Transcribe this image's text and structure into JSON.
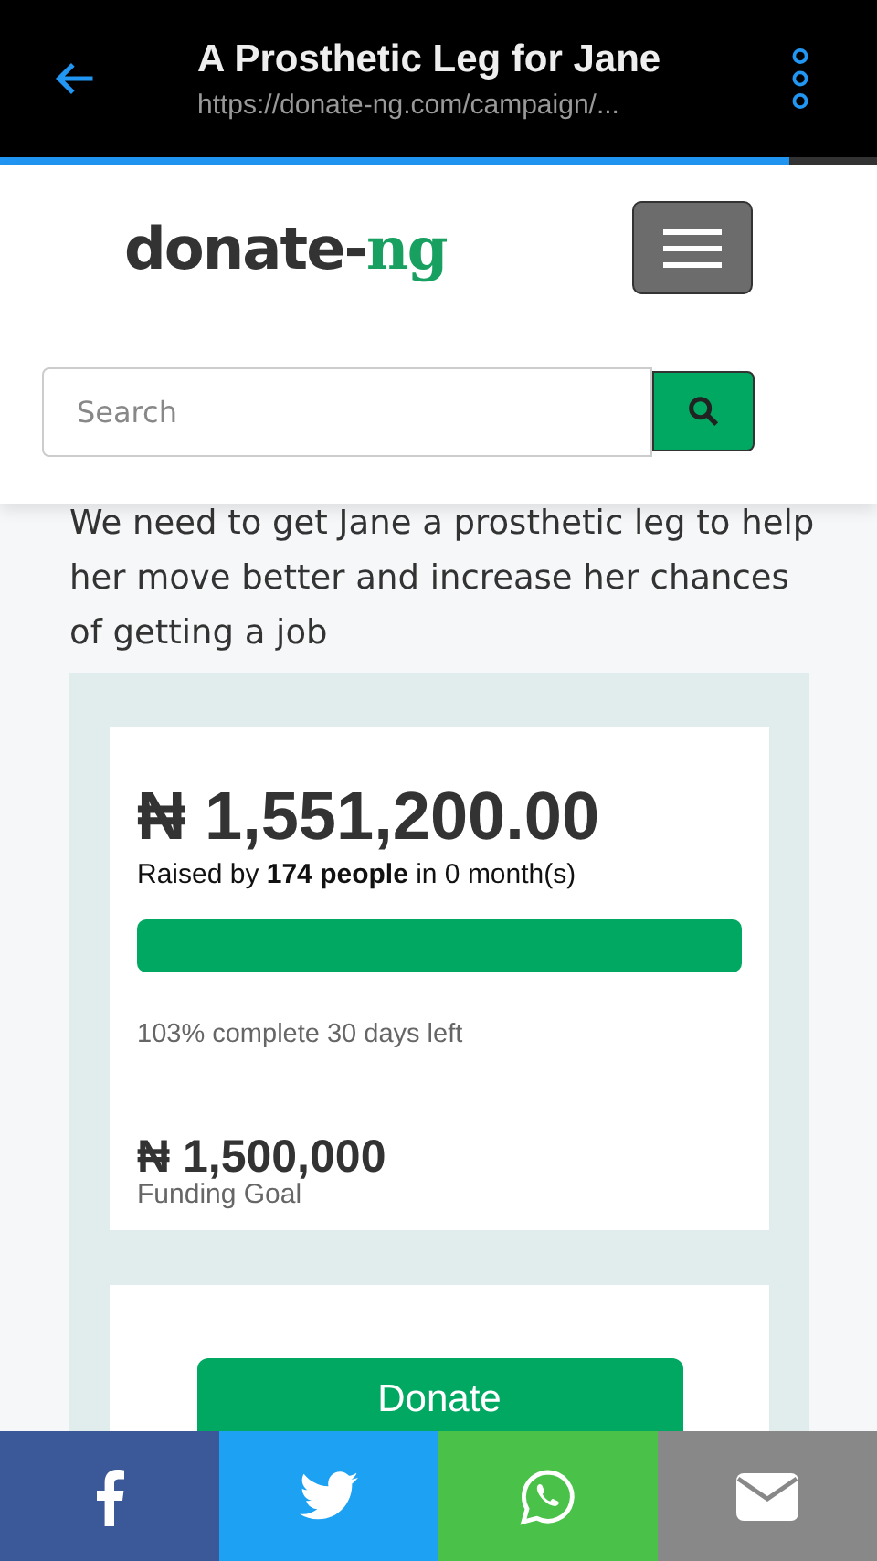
{
  "browser": {
    "title": "A Prosthetic Leg for Jane",
    "url": "https://donate-ng.com/campaign/...",
    "load_progress": {
      "level": 0.9
    }
  },
  "header": {
    "logo": {
      "main": "donate-",
      "accent": "ng"
    },
    "search": {
      "placeholder": "Search"
    }
  },
  "description": "We need to get Jane a prosthetic leg to help her move better and increase her chances of getting a job",
  "campaign": {
    "amount": "₦ 1,551,200.00",
    "raised": "Raised by **174 people** in 0 month(s)",
    "level": 1,
    "progress_text": "103% complete 30 days left",
    "goal": "₦ 1,500,000",
    "goal_label": "Funding Goal"
  },
  "donate_button": "Donate",
  "share": [
    {
      "kind": "facebook",
      "color": "#3b5998"
    },
    {
      "kind": "twitter",
      "color": "#1da1f2"
    },
    {
      "kind": "whatsapp",
      "color": "#4ac24a"
    },
    {
      "kind": "email",
      "color": "#888888"
    }
  ]
}
